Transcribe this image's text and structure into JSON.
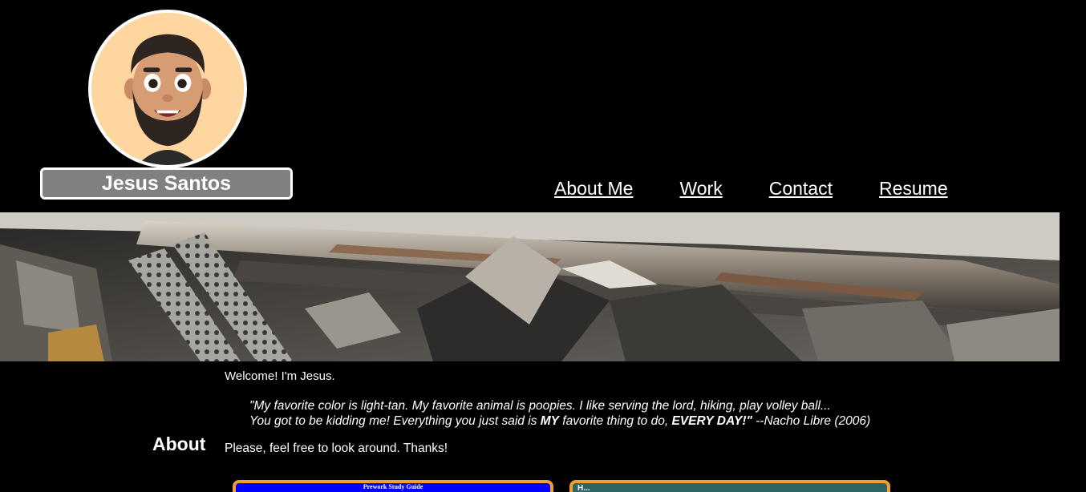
{
  "header": {
    "name": "Jesus Santos",
    "nav": [
      {
        "label": "About Me"
      },
      {
        "label": "Work"
      },
      {
        "label": "Contact"
      },
      {
        "label": "Resume"
      }
    ]
  },
  "about": {
    "heading": "About",
    "welcome": "Welcome! I'm Jesus.",
    "quote": {
      "line1": "\"My favorite color is light-tan. My favorite animal is poopies. I like serving the lord, hiking, play volley ball...",
      "line2_part1": "You got to be kidding me! Everything you just said is ",
      "line2_bold1": "MY",
      "line2_part2": " favorite thing to do, ",
      "line2_bold2": "EVERY DAY!\"",
      "line2_part3": " --Nacho Libre (2006)"
    },
    "closing": "Please, feel free to look around. Thanks!"
  },
  "cards": [
    {
      "title": "Prework Study Guide"
    },
    {
      "title": "H..."
    }
  ],
  "colors": {
    "background": "#000000",
    "name_box": "#808080",
    "card_border": "#f0a030",
    "card1_bg": "#0000ff",
    "card2_bg": "#2f6464"
  }
}
